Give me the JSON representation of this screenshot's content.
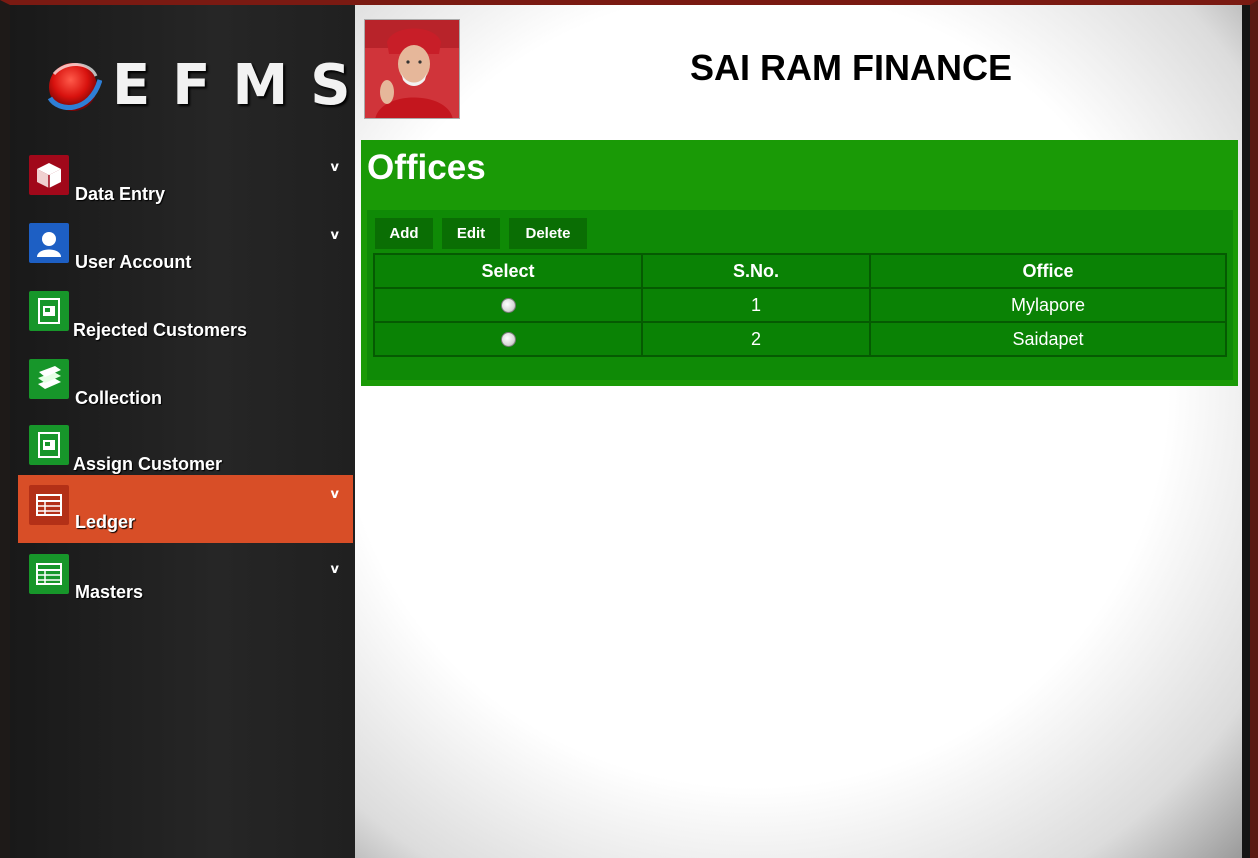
{
  "app": {
    "logo_text": "EFMS",
    "brand_title": "SAI RAM FINANCE"
  },
  "sidebar": {
    "items": [
      {
        "label": "Data Entry",
        "icon": "box-icon",
        "chevron": "v",
        "color": "#a1081a"
      },
      {
        "label": "User Account",
        "icon": "user-icon",
        "chevron": "v",
        "color": "#1d5fc4"
      },
      {
        "label": "Rejected Customers",
        "icon": "document-icon",
        "chevron": "",
        "color": "#17962a"
      },
      {
        "label": "Collection",
        "icon": "books-icon",
        "chevron": "",
        "color": "#17962a"
      },
      {
        "label": "Assign Customer",
        "icon": "document-icon",
        "chevron": "",
        "color": "#17962a"
      },
      {
        "label": "Ledger",
        "icon": "ledger-icon",
        "chevron": "v",
        "color": "#b33017",
        "active": true
      },
      {
        "label": "Masters",
        "icon": "ledger-icon",
        "chevron": "v",
        "color": "#17962a"
      }
    ]
  },
  "panel": {
    "title": "Offices",
    "buttons": {
      "add": "Add",
      "edit": "Edit",
      "delete": "Delete"
    },
    "columns": [
      "Select",
      "S.No.",
      "Office"
    ],
    "rows": [
      {
        "sno": "1",
        "office": "Mylapore"
      },
      {
        "sno": "2",
        "office": "Saidapet"
      }
    ]
  },
  "colors": {
    "active_nav": "#d84e27",
    "panel_green": "#1a9a06"
  }
}
